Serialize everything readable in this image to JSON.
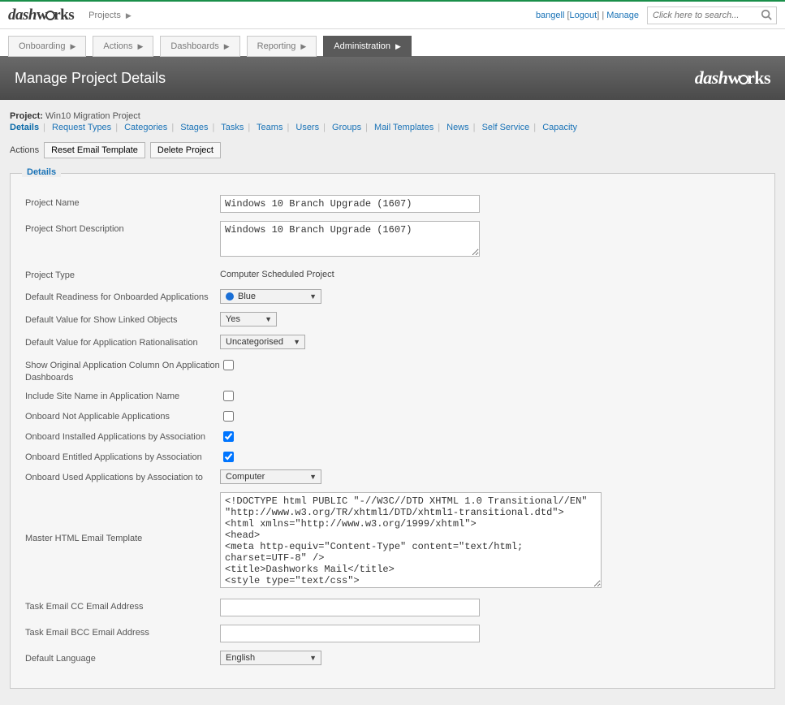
{
  "brand": "dashworks",
  "top_crumb": "Projects",
  "user": {
    "name": "bangell",
    "logout": "Logout",
    "manage": "Manage"
  },
  "search": {
    "placeholder": "Click here to search..."
  },
  "main_tabs": [
    {
      "label": "Onboarding",
      "active": false
    },
    {
      "label": "Actions",
      "active": false
    },
    {
      "label": "Dashboards",
      "active": false
    },
    {
      "label": "Reporting",
      "active": false
    },
    {
      "label": "Administration",
      "active": true
    }
  ],
  "page_title": "Manage Project Details",
  "project": {
    "prefix": "Project:",
    "name": "Win10 Migration Project"
  },
  "sub_nav": [
    "Details",
    "Request Types",
    "Categories",
    "Stages",
    "Tasks",
    "Teams",
    "Users",
    "Groups",
    "Mail Templates",
    "News",
    "Self Service",
    "Capacity"
  ],
  "sub_nav_active": "Details",
  "actions_label": "Actions",
  "action_buttons": {
    "reset": "Reset Email Template",
    "delete": "Delete Project"
  },
  "details_legend": "Details",
  "fields": {
    "project_name": {
      "label": "Project Name",
      "value": "Windows 10 Branch Upgrade (1607)"
    },
    "short_desc": {
      "label": "Project Short Description",
      "value": "Windows 10 Branch Upgrade (1607)"
    },
    "project_type": {
      "label": "Project Type",
      "value": "Computer Scheduled Project"
    },
    "readiness": {
      "label": "Default Readiness for Onboarded Applications",
      "value": "Blue"
    },
    "show_linked": {
      "label": "Default Value for Show Linked Objects",
      "value": "Yes"
    },
    "rationalisation": {
      "label": "Default Value for Application Rationalisation",
      "value": "Uncategorised"
    },
    "show_orig": {
      "label": "Show Original Application Column On Application Dashboards",
      "checked": false
    },
    "include_site": {
      "label": "Include Site Name in Application Name",
      "checked": false
    },
    "onboard_na": {
      "label": "Onboard Not Applicable Applications",
      "checked": false
    },
    "onboard_installed": {
      "label": "Onboard Installed Applications by Association",
      "checked": true
    },
    "onboard_entitled": {
      "label": "Onboard Entitled Applications by Association",
      "checked": true
    },
    "onboard_used": {
      "label": "Onboard Used Applications by Association to",
      "value": "Computer"
    },
    "master_template": {
      "label": "Master HTML Email Template",
      "value": "<!DOCTYPE html PUBLIC \"-//W3C//DTD XHTML 1.0 Transitional//EN\" \"http://www.w3.org/TR/xhtml1/DTD/xhtml1-transitional.dtd\">\n<html xmlns=\"http://www.w3.org/1999/xhtml\">\n<head>\n<meta http-equiv=\"Content-Type\" content=\"text/html; charset=UTF-8\" />\n<title>Dashworks Mail</title>\n<style type=\"text/css\">\n<!--\n        /* Client-specific Styles */\n"
    },
    "cc": {
      "label": "Task Email CC Email Address",
      "value": ""
    },
    "bcc": {
      "label": "Task Email BCC Email Address",
      "value": ""
    },
    "language": {
      "label": "Default Language",
      "value": "English"
    }
  }
}
